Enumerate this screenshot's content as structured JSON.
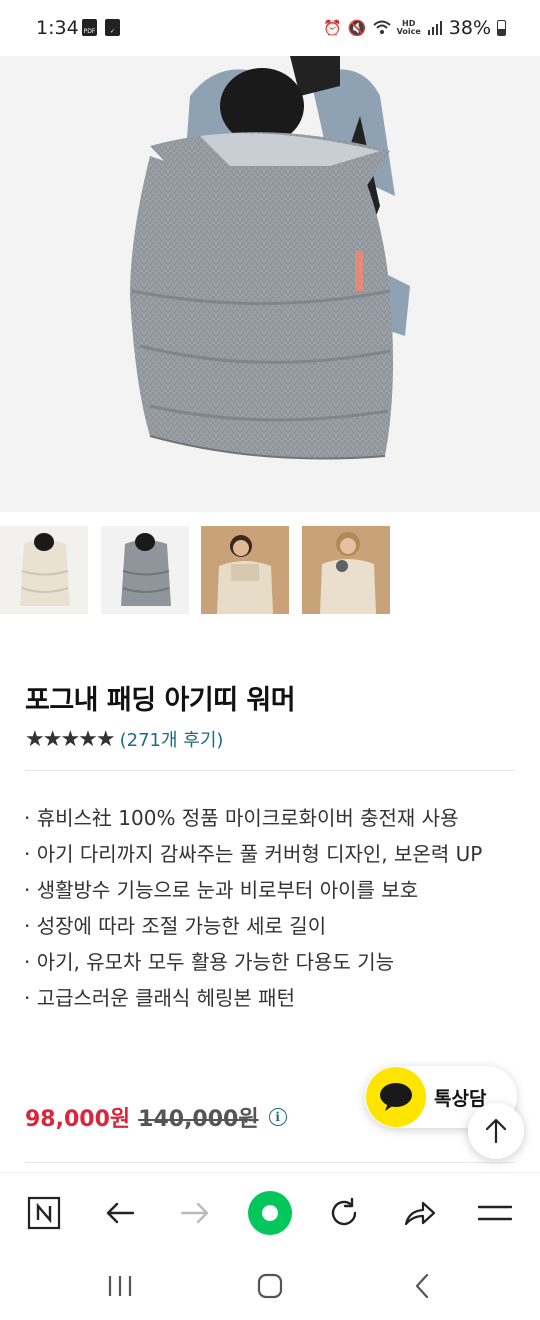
{
  "status_bar": {
    "time": "1:34",
    "battery": "38%",
    "icons": [
      "pdf-icon",
      "check-box-icon",
      "alarm-icon",
      "mute-icon",
      "wifi-icon",
      "hd-voice-icon",
      "signal-icon",
      "battery-icon"
    ],
    "hd_label": "HD"
  },
  "product": {
    "title": "포그내 패딩 아기띠 워머",
    "stars": "★★★★★",
    "review_link": "(271개 후기)",
    "features": [
      "· 휴비스社 100% 정품 마이크로화이버 충전재 사용",
      "· 아기 다리까지 감싸주는 풀 커버형 디자인, 보온력 UP",
      "· 생활방수 기능으로 눈과 비로부터 아이를 보호",
      "· 성장에 따라 조절 가능한 세로 길이",
      "· 아기, 유모차 모두 활용 가능한 다용도 기능",
      "· 고급스러운 클래식 헤링본 패턴"
    ],
    "price_sale": "98,000원",
    "price_original": "140,000원",
    "thumbnails": [
      "beige-warmer",
      "gray-warmer",
      "man-wearing-beige",
      "woman-wearing-beige"
    ]
  },
  "floating": {
    "talk_label": "톡상담",
    "top_icon": "arrow-up-icon"
  },
  "colors": {
    "price_red": "#d9263c",
    "link_teal": "#1a6d86",
    "kakao_yellow": "#fee500",
    "naver_green": "#03c75a"
  },
  "toolbar": {
    "items": [
      "naver-home-icon",
      "back-arrow-icon",
      "forward-arrow-icon",
      "green-dot-icon",
      "refresh-icon",
      "share-icon",
      "menu-icon"
    ]
  },
  "navbar": {
    "items": [
      "recent-apps-icon",
      "home-icon",
      "back-icon"
    ]
  }
}
